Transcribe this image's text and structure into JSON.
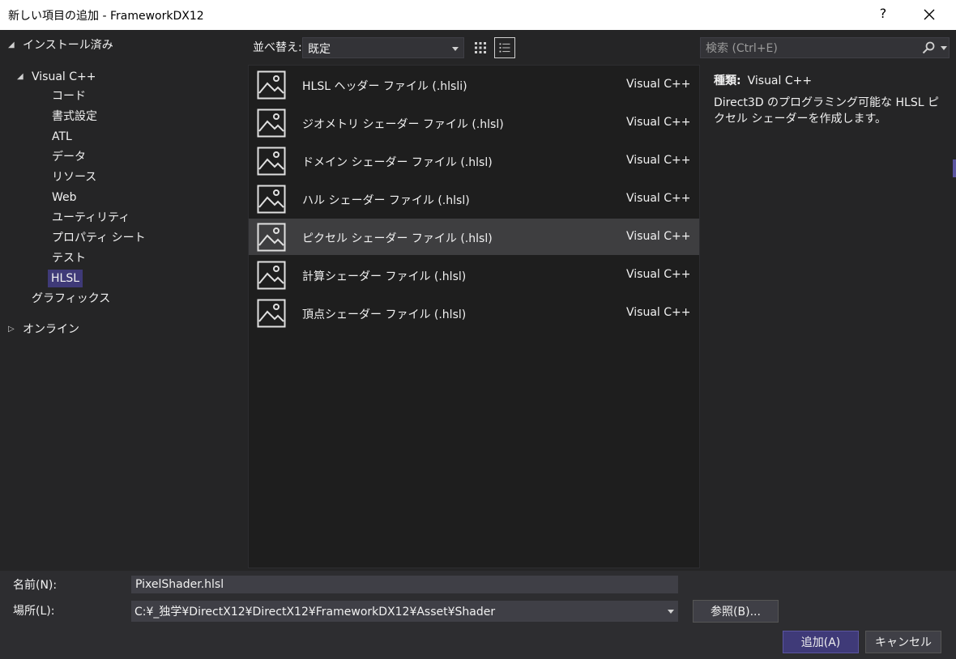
{
  "window": {
    "title": "新しい項目の追加 - FrameworkDX12",
    "help_label": "?"
  },
  "tree": {
    "installed": "インストール済み",
    "visual_cpp": "Visual C++",
    "children": [
      "コード",
      "書式設定",
      "ATL",
      "データ",
      "リソース",
      "Web",
      "ユーティリティ",
      "プロパティ シート",
      "テスト",
      "HLSL"
    ],
    "selected": "HLSL",
    "graphics": "グラフィックス",
    "online": "オンライン"
  },
  "toolbar": {
    "sort_label": "並べ替え:",
    "sort_value": "既定"
  },
  "templates": [
    {
      "name": "HLSL ヘッダー ファイル (.hlsli)",
      "category": "Visual C++"
    },
    {
      "name": "ジオメトリ シェーダー ファイル (.hlsl)",
      "category": "Visual C++"
    },
    {
      "name": "ドメイン シェーダー ファイル (.hlsl)",
      "category": "Visual C++"
    },
    {
      "name": "ハル シェーダー ファイル (.hlsl)",
      "category": "Visual C++"
    },
    {
      "name": "ピクセル シェーダー ファイル (.hlsl)",
      "category": "Visual C++"
    },
    {
      "name": "計算シェーダー ファイル (.hlsl)",
      "category": "Visual C++"
    },
    {
      "name": "頂点シェーダー ファイル (.hlsl)",
      "category": "Visual C++"
    }
  ],
  "selected_template": "ピクセル シェーダー ファイル (.hlsl)",
  "search": {
    "placeholder": "検索 (Ctrl+E)"
  },
  "details": {
    "type_label": "種類:",
    "type_value": "Visual C++",
    "description": "Direct3D のプログラミング可能な HLSL ピクセル シェーダーを作成します。"
  },
  "form": {
    "name_label": "名前(N):",
    "name_value": "PixelShader.hlsl",
    "location_label": "場所(L):",
    "location_value": "C:¥_独学¥DirectX12¥DirectX12¥FrameworkDX12¥Asset¥Shader",
    "browse_label": "参照(B)...",
    "add_label": "追加(A)",
    "cancel_label": "キャンセル"
  }
}
